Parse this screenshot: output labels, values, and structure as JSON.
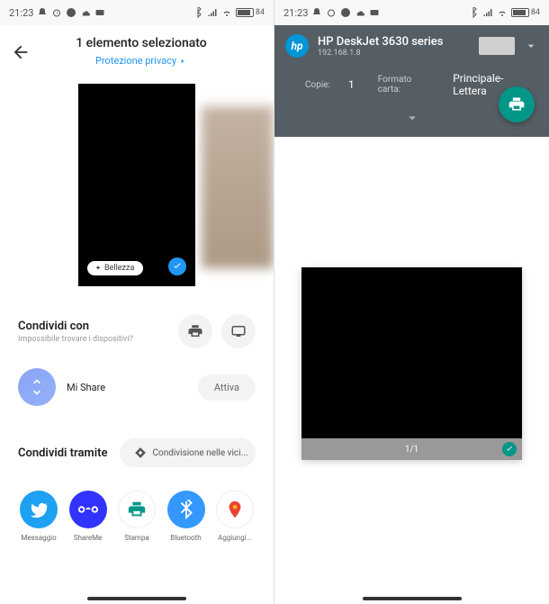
{
  "status": {
    "time": "21:23",
    "battery": "84"
  },
  "left": {
    "title": "1 elemento selezionato",
    "privacy_link": "Protezione privacy",
    "preview_badge": "Bellezza",
    "share_with": {
      "title": "Condividi con",
      "subtitle": "Impossibile trovare i dispositivi?"
    },
    "mishare": {
      "label": "Mi Share",
      "action": "Attiva"
    },
    "share_via": {
      "title": "Condividi tramite",
      "nearby": "Condivisione nelle vici..."
    },
    "apps": [
      "Messaggio",
      "ShareMe",
      "Stampa",
      "Bluetooth",
      "Aggiungi..."
    ]
  },
  "right": {
    "printer_name": "HP DeskJet 3630 series",
    "printer_ip": "192.168.1.8",
    "copies_label": "Copie:",
    "copies_value": "1",
    "paper_label": "Formato carta:",
    "paper_value": "Principale-Lettera",
    "page_indicator": "1/1"
  }
}
